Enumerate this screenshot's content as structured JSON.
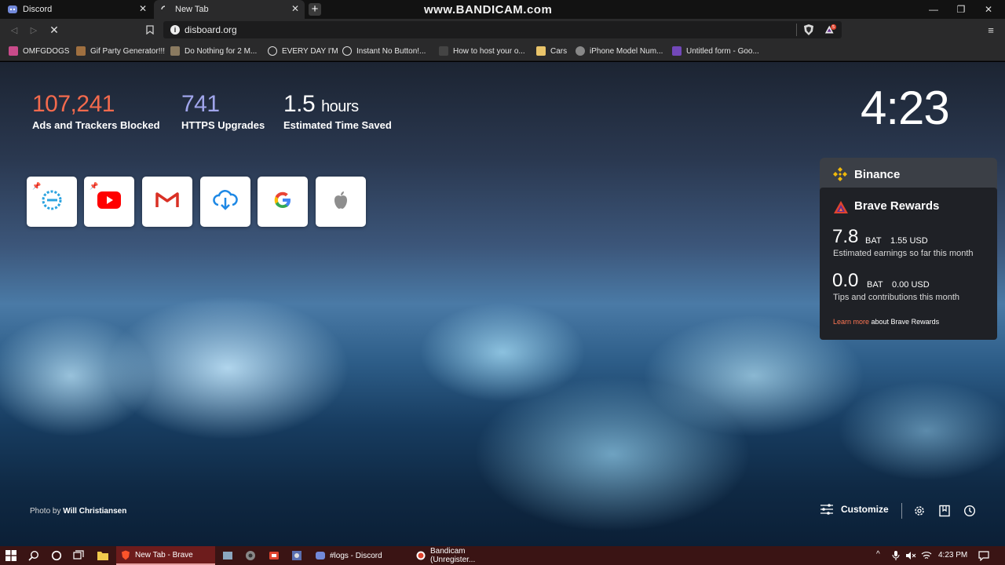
{
  "window": {
    "tabs": [
      {
        "label": "Discord",
        "icon": "discord-icon"
      },
      {
        "label": "New Tab",
        "icon": "loading-icon"
      }
    ],
    "watermark": "www.BANDICAM.com"
  },
  "toolbar": {
    "url": "disboard.org"
  },
  "bookmarks": [
    {
      "label": "OMFGDOGS",
      "icon": "dog-icon",
      "color": "#c94b8a"
    },
    {
      "label": "Gif Party Generator!!!",
      "icon": "party-icon",
      "color": "#a07040"
    },
    {
      "label": "Do Nothing for 2 M...",
      "icon": "photo-icon",
      "color": "#8a7a60"
    },
    {
      "label": "EVERY DAY I'M",
      "icon": "globe-icon",
      "color": "#dddddd"
    },
    {
      "label": "Instant No Button!...",
      "icon": "globe-icon",
      "color": "#dddddd"
    },
    {
      "label": "How to host your o...",
      "icon": "page-icon",
      "color": "#444444"
    },
    {
      "label": "Cars",
      "icon": "folder-icon",
      "color": "#e9c46a"
    },
    {
      "label": "iPhone Model Num...",
      "icon": "apple-icon",
      "color": "#888888"
    },
    {
      "label": "Untitled form - Goo...",
      "icon": "forms-icon",
      "color": "#7248b9"
    }
  ],
  "stats": {
    "ads_blocked": "107,241",
    "ads_label": "Ads and Trackers Blocked",
    "https_upgrades": "741",
    "https_label": "HTTPS Upgrades",
    "time_saved": "1.5",
    "time_unit": "hours",
    "time_label": "Estimated Time Saved"
  },
  "clock": "4:23",
  "top_sites": [
    {
      "name": "site-1",
      "icon": "ring-icon",
      "pinned": true
    },
    {
      "name": "youtube",
      "icon": "youtube-icon",
      "pinned": true
    },
    {
      "name": "gmail",
      "icon": "gmail-icon",
      "pinned": false
    },
    {
      "name": "download",
      "icon": "cloud-download-icon",
      "pinned": false
    },
    {
      "name": "google",
      "icon": "google-icon",
      "pinned": false
    },
    {
      "name": "apple",
      "icon": "apple-icon",
      "pinned": false
    }
  ],
  "binance": {
    "title": "Binance"
  },
  "rewards": {
    "title": "Brave Rewards",
    "earnings_value": "7.8",
    "earnings_unit": "BAT",
    "earnings_usd": "1.55 USD",
    "earnings_desc": "Estimated earnings so far this month",
    "tips_value": "0.0",
    "tips_unit": "BAT",
    "tips_usd": "0.00 USD",
    "tips_desc": "Tips and contributions this month",
    "learn_more_link": "Learn more",
    "learn_more_rest": " about Brave Rewards"
  },
  "photo_credit": {
    "prefix": "Photo by ",
    "author": "Will Christiansen"
  },
  "footer": {
    "customize_label": "Customize"
  },
  "taskbar": {
    "apps": [
      {
        "label": "New Tab - Brave",
        "icon": "brave-icon",
        "active": true
      },
      {
        "label": "#logs - Discord",
        "icon": "discord-icon",
        "active": false
      },
      {
        "label": "Bandicam (Unregister...",
        "icon": "record-icon",
        "active": false
      }
    ],
    "time": "4:23 PM"
  },
  "colors": {
    "ads_blocked": "#f36a4d",
    "https": "#a0a5eb",
    "link": "#ff7654",
    "taskbar": "#3a1414"
  }
}
